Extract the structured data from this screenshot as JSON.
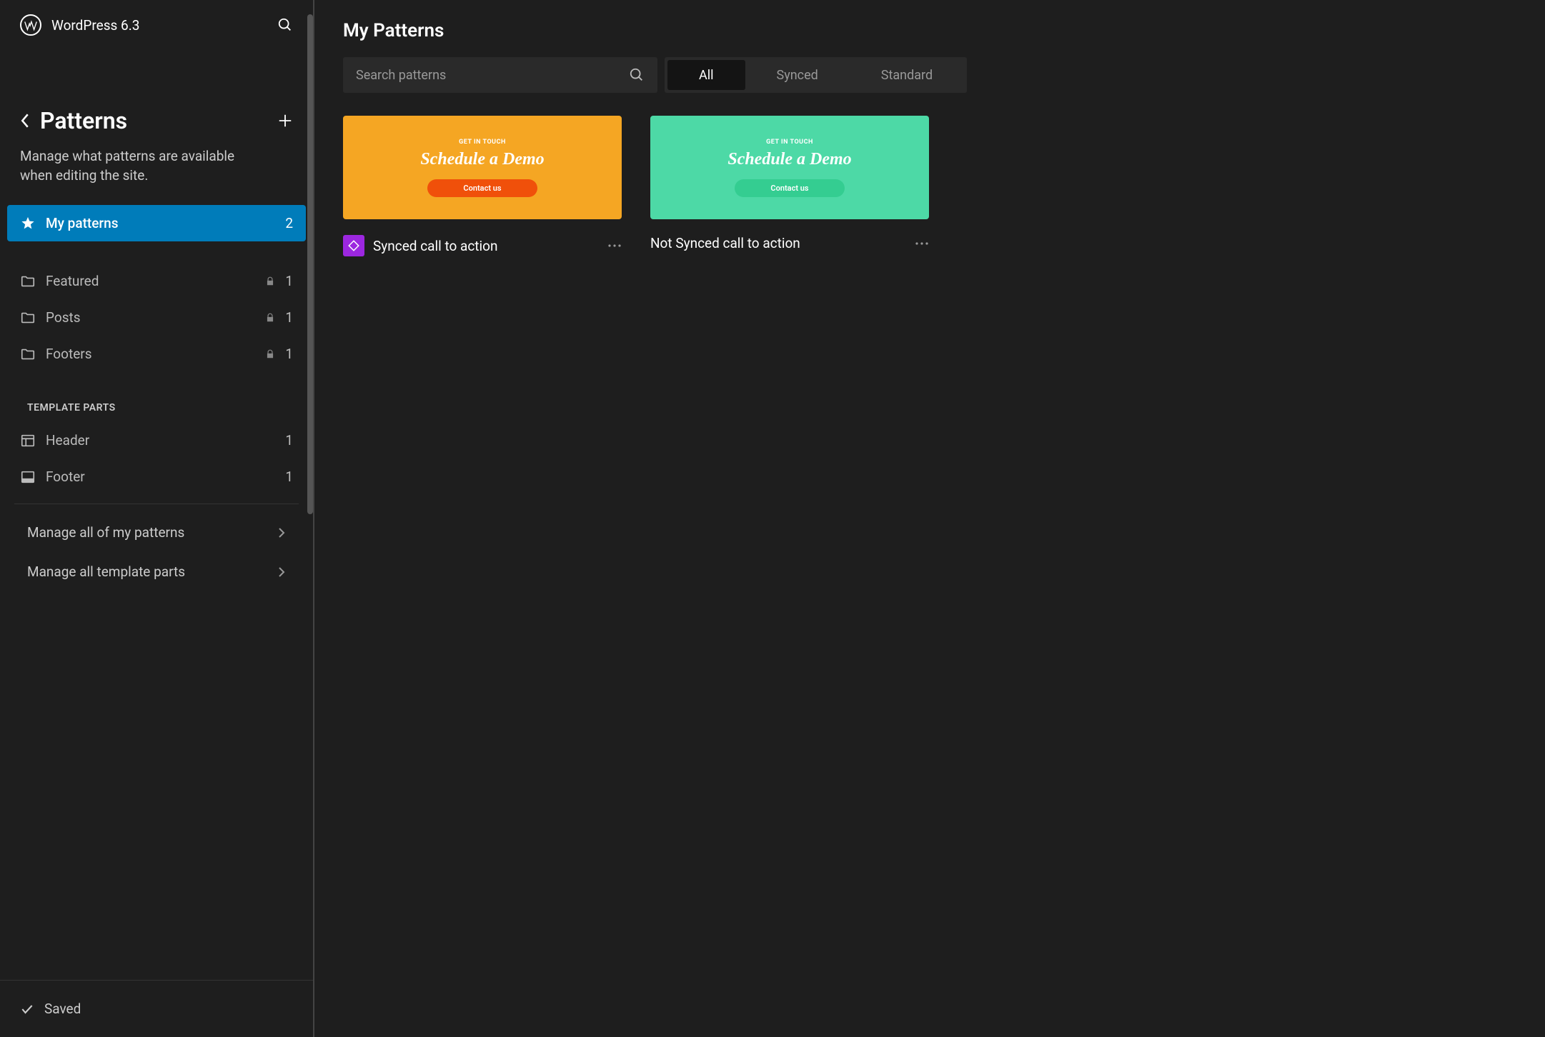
{
  "header": {
    "site_title": "WordPress 6.3"
  },
  "sidebar": {
    "title": "Patterns",
    "description": "Manage what patterns are available when editing the site.",
    "items": [
      {
        "label": "My patterns",
        "count": "2",
        "type": "star",
        "active": true
      },
      {
        "label": "Featured",
        "count": "1",
        "type": "folder",
        "locked": true
      },
      {
        "label": "Posts",
        "count": "1",
        "type": "folder",
        "locked": true
      },
      {
        "label": "Footers",
        "count": "1",
        "type": "folder",
        "locked": true
      }
    ],
    "template_heading": "TEMPLATE PARTS",
    "template_parts": [
      {
        "label": "Header",
        "count": "1",
        "type": "header"
      },
      {
        "label": "Footer",
        "count": "1",
        "type": "footer"
      }
    ],
    "manage": [
      {
        "label": "Manage all of my patterns"
      },
      {
        "label": "Manage all template parts"
      }
    ],
    "saved_label": "Saved"
  },
  "main": {
    "title": "My Patterns",
    "search": {
      "placeholder": "Search patterns"
    },
    "filter_tabs": [
      {
        "label": "All",
        "active": true
      },
      {
        "label": "Synced"
      },
      {
        "label": "Standard"
      }
    ],
    "cards": [
      {
        "title": "Synced call to action",
        "synced": true,
        "preview": {
          "bg": "orange",
          "eyebrow": "GET IN TOUCH",
          "heading": "Schedule a Demo",
          "button": "Contact us"
        }
      },
      {
        "title": "Not Synced call to action",
        "synced": false,
        "preview": {
          "bg": "green",
          "eyebrow": "GET IN TOUCH",
          "heading": "Schedule a Demo",
          "button": "Contact us"
        }
      }
    ]
  }
}
